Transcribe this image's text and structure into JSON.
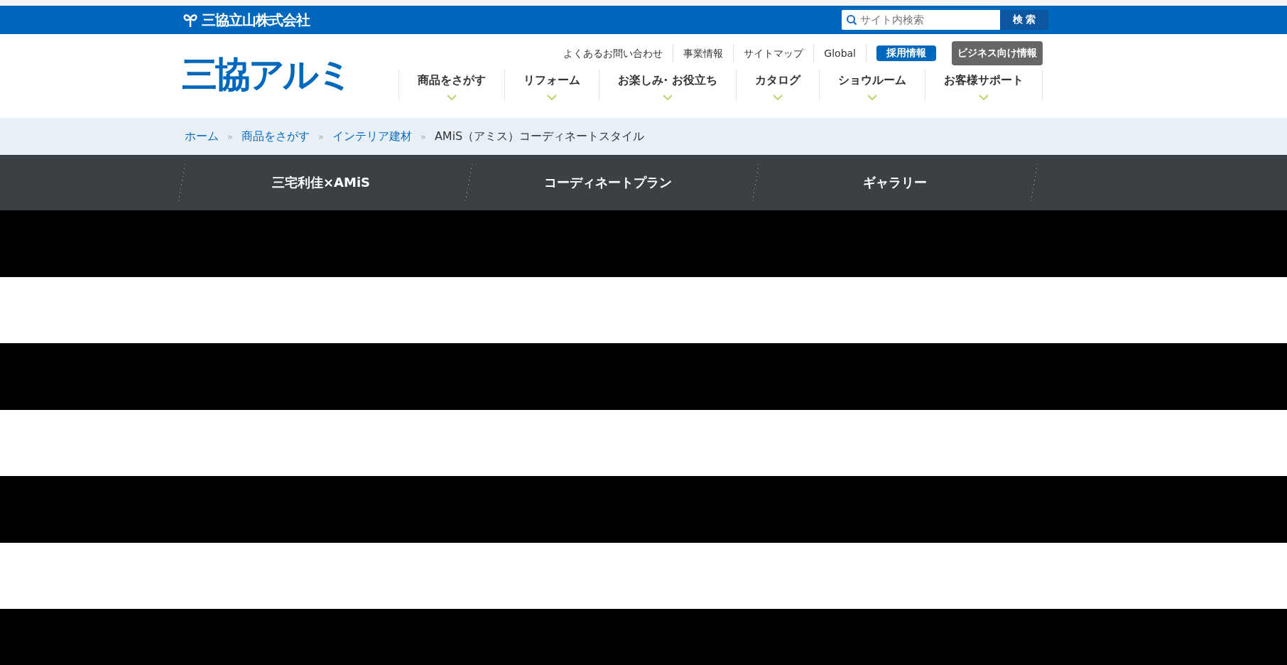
{
  "top_bar": {
    "company": "三協立山株式会社",
    "search": {
      "placeholder": "サイト内検索",
      "button": "検 索"
    }
  },
  "header": {
    "logo": "三協アルミ",
    "utility_links": [
      {
        "label": "よくあるお問い合わせ",
        "kind": "link"
      },
      {
        "label": "事業情報",
        "kind": "link"
      },
      {
        "label": "サイトマップ",
        "kind": "link"
      },
      {
        "label": "Global",
        "kind": "link"
      },
      {
        "label": "採用情報",
        "kind": "primary"
      },
      {
        "label": "ビジネス向け情報",
        "kind": "secondary"
      }
    ],
    "nav": [
      {
        "label": "商品をさがす"
      },
      {
        "label": "リフォーム"
      },
      {
        "label": "お楽しみ· お役立ち"
      },
      {
        "label": "カタログ"
      },
      {
        "label": "ショウルーム"
      },
      {
        "label": "お客様サポート"
      }
    ]
  },
  "breadcrumb": [
    {
      "label": "ホーム",
      "link": true
    },
    {
      "separator": "»",
      "label": "商品をさがす",
      "link": true
    },
    {
      "separator": "»",
      "label": "インテリア建材",
      "link": true
    },
    {
      "separator": "»",
      "label": "AMiS（アミス）コーディネートスタイル",
      "link": false
    }
  ],
  "sub_nav": [
    {
      "label": "三宅利佳×AMiS"
    },
    {
      "label": "コーディネートプラン"
    },
    {
      "label": "ギャラリー"
    }
  ],
  "bands": [
    {
      "kind": "dark"
    },
    {
      "kind": "light"
    },
    {
      "kind": "dark"
    },
    {
      "kind": "light"
    },
    {
      "kind": "dark"
    },
    {
      "kind": "light"
    },
    {
      "kind": "dark"
    }
  ]
}
